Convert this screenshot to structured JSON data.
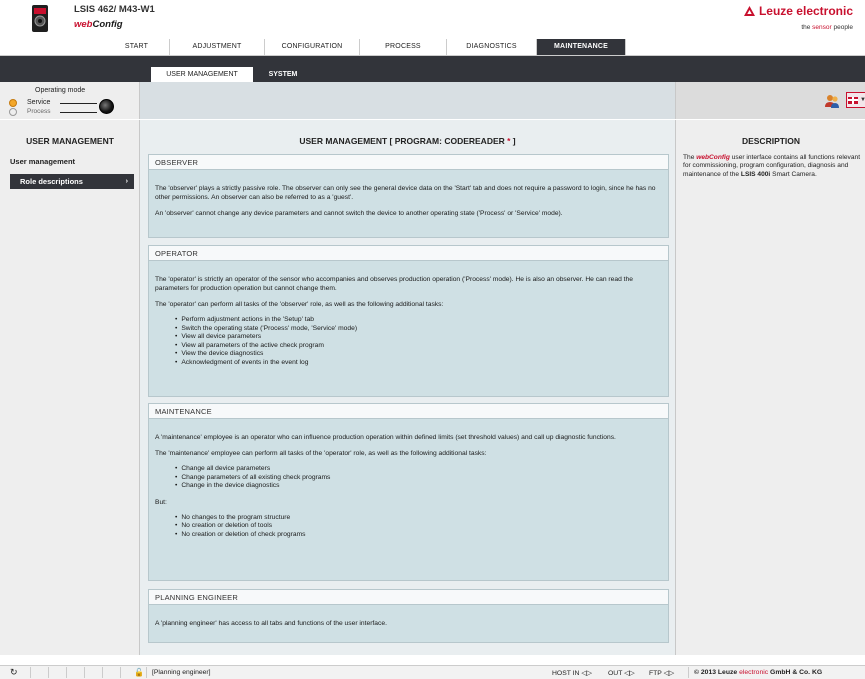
{
  "header": {
    "product_title": "LSIS 462/ M43-W1",
    "app_prefix": "web",
    "app_suffix": "Config",
    "brand": "Leuze electronic",
    "tagline_pre": "the ",
    "tagline_red": "sensor",
    "tagline_post": " people"
  },
  "main_tabs": [
    "START",
    "ADJUSTMENT",
    "CONFIGURATION",
    "PROCESS",
    "DIAGNOSTICS",
    "MAINTENANCE"
  ],
  "sub_tabs": [
    "USER MANAGEMENT",
    "SYSTEM"
  ],
  "mode": {
    "title": "Operating mode",
    "service": "Service",
    "process": "Process"
  },
  "sidebar": {
    "heading": "USER MANAGEMENT",
    "items": [
      "User management",
      "Role descriptions"
    ],
    "arrow": "›"
  },
  "main": {
    "heading": "USER MANAGEMENT   [ PROGRAM: CODEREADER ",
    "heading_star": "*",
    "heading_close": " ]",
    "observer": {
      "title": "OBSERVER",
      "p1": "The 'observer' plays a strictly passive role. The observer can only see the general device data on the 'Start' tab and does not require a password to login, since he has no other permissions. An observer can also be referred to as a 'guest'.",
      "p2": "An 'observer' cannot change any device parameters and cannot switch the device to another operating state ('Process' or 'Service' mode)."
    },
    "operator": {
      "title": "OPERATOR",
      "p1": "The 'operator' is strictly an operator of the sensor who accompanies and observes production operation ('Process' mode). He is also an observer. He can read the parameters for production operation but cannot change them.",
      "p2": "The 'operator' can perform all tasks of the 'observer' role, as well as the following additional tasks:",
      "items": [
        "Perform adjustment actions in the 'Setup' tab",
        "Switch the operating state ('Process' mode, 'Service' mode)",
        "View all device parameters",
        "View all parameters of the active check program",
        "View the device diagnostics",
        "Acknowledgment of events in the event log"
      ]
    },
    "maintenance": {
      "title": "MAINTENANCE",
      "p1": "A 'maintenance' employee is an operator who can influence production operation within defined limits (set threshold values) and call up diagnostic functions.",
      "p2": "The 'maintenance' employee can perform all tasks of the 'operator' role, as well as the following additional tasks:",
      "items": [
        "Change all device parameters",
        "Change parameters of all existing check programs",
        "Change in the device diagnostics"
      ],
      "p3": "But:",
      "items2": [
        "No changes to the program structure",
        "No creation or deletion of tools",
        "No creation or deletion of check programs"
      ]
    },
    "planning": {
      "title": "PLANNING ENGINEER",
      "p1": "A 'planning engineer' has access to all tabs and functions of the user interface."
    }
  },
  "description": {
    "heading": "DESCRIPTION",
    "t1": "The ",
    "wc": "webConfig",
    "t2": " user interface contains all functions relevant for commissioning, program configuration, diagnosis and maintenance of the ",
    "bold": "LSIS 400i",
    "t3": " Smart Camera."
  },
  "footer": {
    "user": "[Planning engineer]",
    "host": "HOST IN",
    "out": "OUT",
    "ftp": "FTP",
    "copy_pre": "© 2013 Leuze ",
    "copy_red": "electronic",
    "copy_post": " GmbH & Co. KG"
  },
  "colors": {
    "brand_red": "#c8102e",
    "dark_bar": "#32343a",
    "panel_blue": "#cfe0e4"
  },
  "icons": [
    "camera-icon",
    "leuze-triangle-icon",
    "users-icon",
    "flag-icon",
    "refresh-icon",
    "lock-icon",
    "speaker-icon"
  ]
}
